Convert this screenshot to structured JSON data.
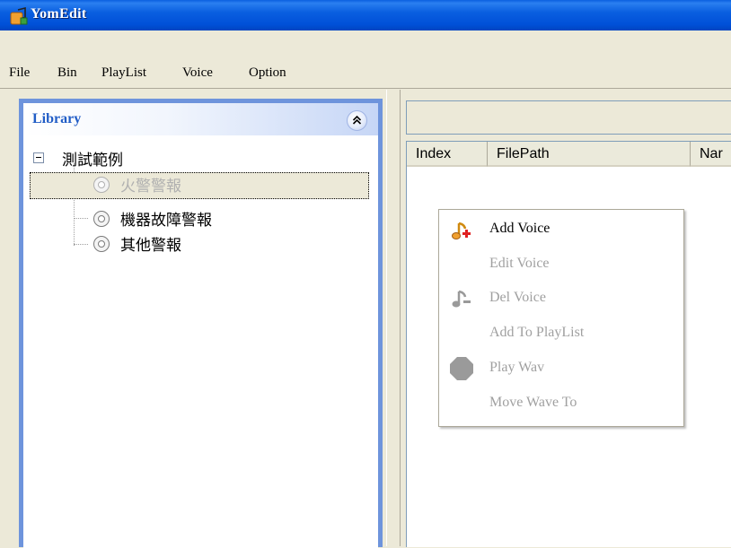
{
  "window": {
    "title": "YomEdit"
  },
  "menu": [
    "File",
    "Bin",
    "PlayList",
    "Voice",
    "Option"
  ],
  "library": {
    "title": "Library",
    "root": {
      "label": "測試範例",
      "expanded": true
    },
    "items": [
      {
        "label": "火警警報",
        "selected": true
      },
      {
        "label": "機器故障警報",
        "selected": false
      },
      {
        "label": "其他警報",
        "selected": false
      }
    ]
  },
  "list": {
    "columns": [
      "Index",
      "FilePath",
      "Nar"
    ]
  },
  "context_menu": {
    "items": [
      {
        "label": "Add  Voice",
        "enabled": true,
        "icon": "note-add-icon"
      },
      {
        "label": "Edit Voice",
        "enabled": false,
        "icon": ""
      },
      {
        "label": "Del Voice",
        "enabled": false,
        "icon": "note-remove-icon"
      },
      {
        "label": "Add  To PlayList",
        "enabled": false,
        "icon": ""
      },
      {
        "label": "Play Wav",
        "enabled": false,
        "icon": "stop-octagon-icon"
      },
      {
        "label": "Move Wave To",
        "enabled": false,
        "icon": ""
      }
    ]
  },
  "colors": {
    "title_bar": "#0a5fe0",
    "accent": "#215dc6",
    "panel_border": "#6e94dc"
  }
}
